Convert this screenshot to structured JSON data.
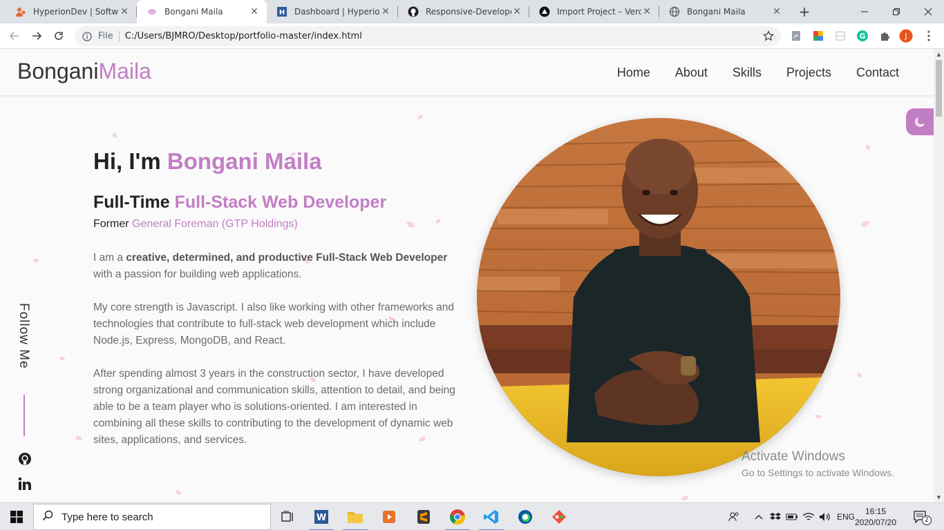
{
  "browser": {
    "tabs": [
      {
        "label": "HyperionDev | Software",
        "icon": "hyperiondev-icon"
      },
      {
        "label": "Bongani Maila",
        "icon": "petal-favicon-icon"
      },
      {
        "label": "Dashboard | HyperionD",
        "icon": "hyperion-dashboard-icon"
      },
      {
        "label": "Responsive-Developer-",
        "icon": "github-icon"
      },
      {
        "label": "Import Project – Vercel",
        "icon": "vercel-icon"
      },
      {
        "label": "Bongani Maila",
        "icon": "globe-icon"
      }
    ],
    "address": {
      "scheme_label": "File",
      "url": "C:/Users/BJMRO/Desktop/portfolio-master/index.html"
    },
    "profile_initial": "J"
  },
  "site": {
    "logo_first": "Bongani",
    "logo_second": "Maila",
    "nav": [
      "Home",
      "About",
      "Skills",
      "Projects",
      "Contact"
    ],
    "greeting_prefix": "Hi, I'm ",
    "greeting_name": "Bongani Maila",
    "role_prefix": "Full-Time ",
    "role_title": "Full-Stack Web Developer",
    "former_prefix": "Former ",
    "former_role": "General Foreman (GTP Holdings)",
    "para1": {
      "before": "I am a ",
      "bold": "creative, determined, and productive",
      "emph": " Full-Stack Web Developer",
      "after": " with a passion for building web applications."
    },
    "para2": "My core strength is Javascript. I also like working with other frameworks and technologies that contribute to full-stack web development which include Node.js, Express, MongoDB, and React.",
    "para3": "After spending almost 3 years in the construction sector, I have developed strong organizational and communication skills, attention to detail, and being able to be a team player who is solutions-oriented. I am interested in combining all these skills to contributing to the development of dynamic web sites, applications, and services.",
    "follow_label": "Follow Me",
    "social": [
      "github-icon",
      "linkedin-icon"
    ],
    "accent_color": "#c27ec5"
  },
  "watermark": {
    "line1": "Activate Windows",
    "line2": "Go to Settings to activate Windows."
  },
  "taskbar": {
    "search_placeholder": "Type here to search",
    "language": "ENG",
    "time": "16:15",
    "date": "2020/07/20",
    "notification_count": "2"
  }
}
